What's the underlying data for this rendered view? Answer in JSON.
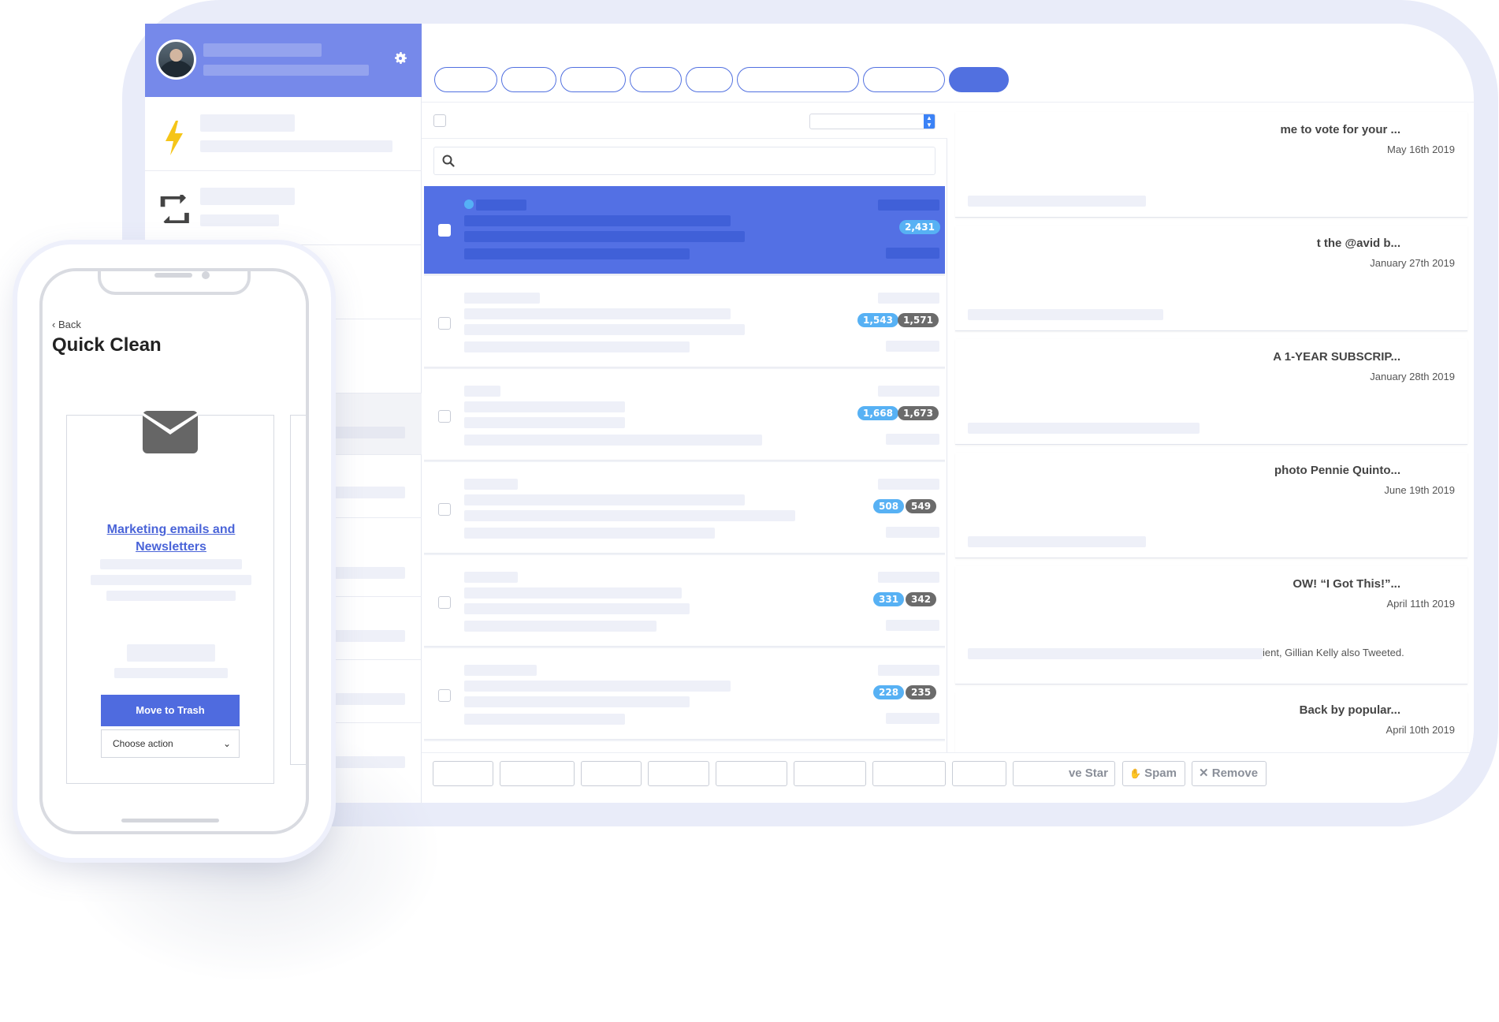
{
  "colors": {
    "accent": "#5170e0",
    "header": "#7689ea",
    "selected_row": "#5370e4",
    "badge_blue": "#57b1f4",
    "badge_gray": "#6b6b6b",
    "lightning": "#f5c518"
  },
  "icons": {
    "settings": "gear-icon",
    "auto_rule": "lightning-icon",
    "recurring": "retweet-icon",
    "search": "search-icon",
    "envelope": "envelope-icon"
  },
  "senders": [
    {
      "count_a": "2,431",
      "count_b": "",
      "selected": true
    },
    {
      "count_a": "1,543",
      "count_b": "1,571",
      "selected": false
    },
    {
      "count_a": "1,668",
      "count_b": "1,673",
      "selected": false
    },
    {
      "count_a": "508",
      "count_b": "549",
      "selected": false
    },
    {
      "count_a": "331",
      "count_b": "342",
      "selected": false
    },
    {
      "count_a": "228",
      "count_b": "235",
      "selected": false
    }
  ],
  "previews": [
    {
      "subject": "me to vote for your ...",
      "date": "May 16th 2019",
      "snippet": ""
    },
    {
      "subject": "t the @avid b...",
      "date": "January 27th 2019",
      "snippet": ""
    },
    {
      "subject": "A 1-YEAR SUBSCRIP...",
      "date": "January 28th 2019",
      "snippet": ""
    },
    {
      "subject": "photo Pennie Quinto...",
      "date": "June 19th 2019",
      "snippet": ""
    },
    {
      "subject": "OW! “I Got This!”...",
      "date": "April 11th 2019",
      "snippet": "ient, Gillian Kelly also Tweeted."
    },
    {
      "subject": "Back by popular...",
      "date": "April 10th 2019",
      "snippet": ""
    }
  ],
  "actions": {
    "star": "ve Star",
    "spam": "Spam",
    "remove": "Remove"
  },
  "phone": {
    "back": "Back",
    "title": "Quick Clean",
    "category_link": "Marketing emails and Newsletters",
    "primary_button": "Move to Trash",
    "select_value": "Choose action"
  }
}
